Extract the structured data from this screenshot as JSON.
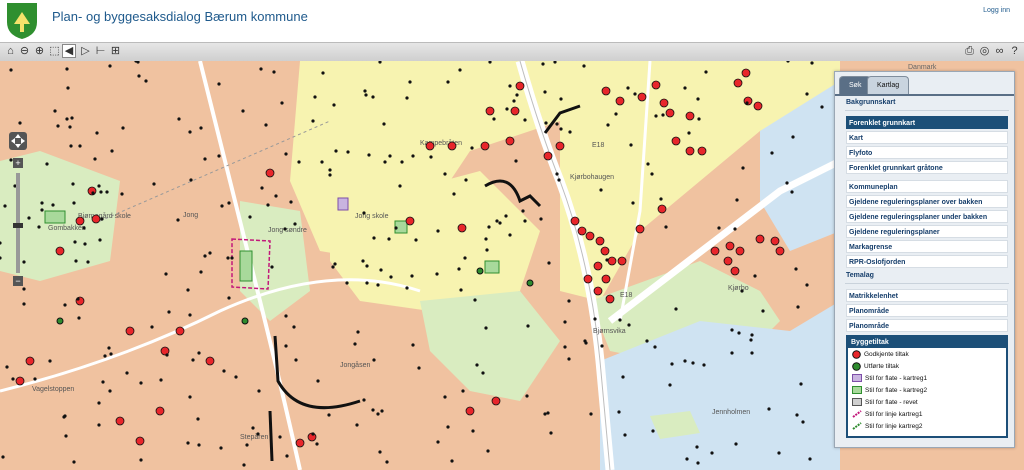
{
  "header": {
    "title": "Plan- og byggesaksdialog Bærum kommune",
    "login": "Logg inn"
  },
  "map": {
    "labels": {
      "danmark": "Danmark",
      "kampebraten": "Kampebråten",
      "kjorbohaugen": "Kjørbohaugen",
      "bjornegard": "Bjørnegård skole",
      "gombakken": "Gombakken",
      "jong": "Jong",
      "jong_skole": "Jong skole",
      "jong_sondre": "Jong søndre",
      "kjorbo": "Kjørbo",
      "jongasen": "Jongåsen",
      "bjornsvika": "Bjørnsvika",
      "vagelstoppen": "Vagelstoppen",
      "jennholmen": "Jennholmen",
      "steparen": "Stepåren",
      "e18_a": "E18",
      "e18_b": "E18"
    }
  },
  "panel": {
    "tabs": [
      "Søk",
      "Kartlag"
    ],
    "active_tab": "Kartlag",
    "bakgrunn_title": "Bakgrunnskart",
    "bakgrunn": [
      "Forenklet grunnkart",
      "Kart",
      "Flyfoto",
      "Forenklet grunnkart gråtone"
    ],
    "selected_bakgrunn": "Forenklet grunnkart",
    "plan": [
      "Kommuneplan",
      "Gjeldene reguleringsplaner over bakken",
      "Gjeldene reguleringsplaner under bakken",
      "Gjeldene reguleringsplaner",
      "Markagrense",
      "RPR-Oslofjorden"
    ],
    "tema_title": "Temalag",
    "tema": [
      "Matrikkelenhet",
      "Planområde",
      "Planområde"
    ],
    "legend": {
      "title": "Byggetiltak",
      "items": [
        "Godkjente tiltak",
        "Utførte tiltak",
        "Stil for flate - kartreg1",
        "Stil for flate - kartreg2",
        "Stil for flate - revet",
        "Stil for linje kartreg1",
        "Stil for linje kartreg2"
      ]
    }
  },
  "colors": {
    "header_text": "#1f5a8c",
    "panel_selected": "#1c4f78",
    "marker_approved": "#e8262b",
    "marker_done": "#2e8b2e",
    "residential": "#f0c2a0",
    "forest": "#d9ecc0",
    "water": "#cfe3f2",
    "field": "#f7f3b0"
  },
  "icons": {
    "logo": "baerum-shield-icon",
    "toolbar_left": [
      "home-icon",
      "zoom-out-icon",
      "zoom-in-icon",
      "zoom-box-icon",
      "back-icon",
      "forward-icon",
      "measure-line-icon",
      "measure-area-icon"
    ],
    "toolbar_right": [
      "print-icon",
      "gps-icon",
      "link-icon",
      "help-icon"
    ]
  }
}
